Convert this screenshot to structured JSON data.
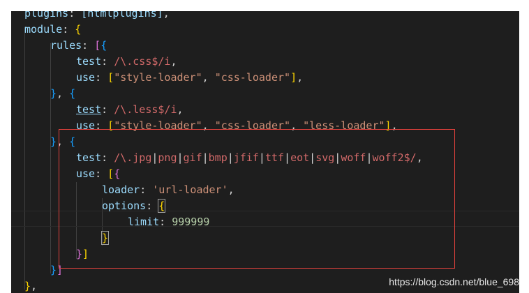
{
  "code": {
    "l0": {
      "k": "plugins",
      "c": ": ",
      "v": "[htmlplugins]",
      "e": ","
    },
    "l1": {
      "k": "module",
      "c": ": ",
      "o": "{"
    },
    "l2": {
      "k": "rules",
      "c": ": ",
      "o1": "[",
      "o2": "{"
    },
    "l3": {
      "k": "test",
      "c": ": ",
      "re_open": "/\\.css$/i",
      "e": ","
    },
    "l4": {
      "k": "use",
      "c": ": ",
      "o": "[",
      "s1": "\"style-loader\"",
      "sep": ", ",
      "s2": "\"css-loader\"",
      "cl": "]",
      "e": ","
    },
    "l5": {
      "c1": "}",
      "sep": ", ",
      "o": "{"
    },
    "l6": {
      "k": "test",
      "c": ": ",
      "re": "/\\.less$/i",
      "e": ","
    },
    "l7": {
      "k": "use",
      "c": ": ",
      "o": "[",
      "s1": "\"style-loader\"",
      "sep1": ", ",
      "s2": "\"css-loader\"",
      "sep2": ", ",
      "s3": "\"less-loader\"",
      "cl": "]",
      "e": ","
    },
    "l8": {
      "c1": "}",
      "sep": ", ",
      "o": "{"
    },
    "l9": {
      "k": "test",
      "c": ": ",
      "re_start": "/\\.",
      "exts": [
        "jpg",
        "png",
        "gif",
        "bmp",
        "jfif",
        "ttf",
        "eot",
        "svg",
        "woff",
        "woff2"
      ],
      "pipe": "|",
      "re_end": "$/",
      "e": ","
    },
    "l10": {
      "k": "use",
      "c": ": ",
      "o1": "[",
      "o2": "{"
    },
    "l11": {
      "k": "loader",
      "c": ": ",
      "s": "'url-loader'",
      "e": ","
    },
    "l12": {
      "k": "options",
      "c": ": ",
      "o": "{"
    },
    "l13": {
      "k": "limit",
      "c": ": ",
      "n": "999999"
    },
    "l14": {
      "cl": "}"
    },
    "l15": {
      "cl1": "}",
      "cl2": "]"
    },
    "l16": {
      "cl1": "}",
      "cl2": "]"
    },
    "l17": {
      "cl": "}",
      "e": ","
    }
  },
  "watermark": "https://blog.csdn.net/blue_698"
}
